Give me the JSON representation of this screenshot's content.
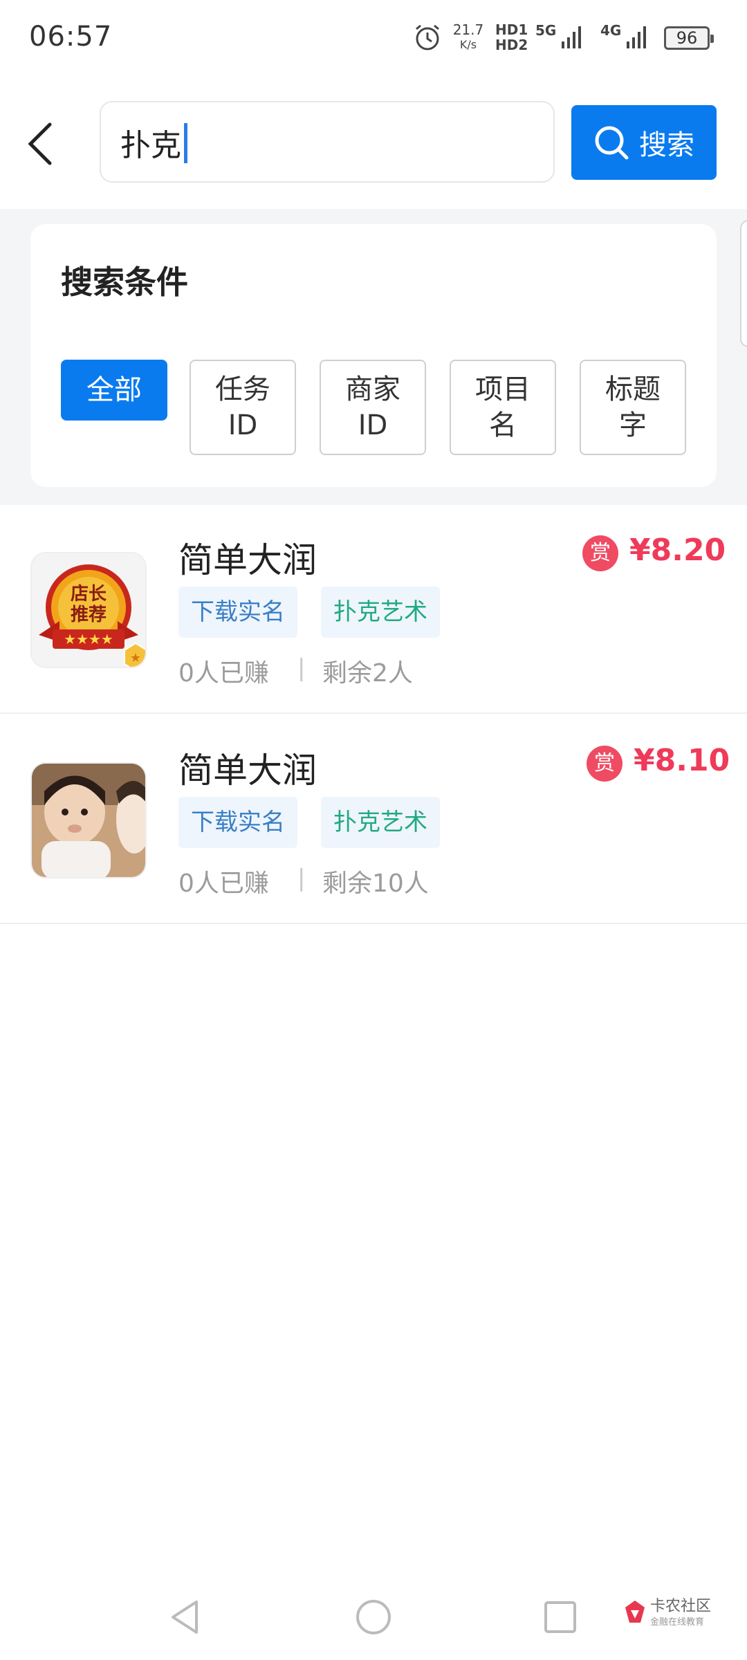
{
  "status_bar": {
    "time": "06:57",
    "net_speed_value": "21.7",
    "net_speed_unit": "K/s",
    "hd1": "HD1",
    "hd2": "HD2",
    "network_5g": "5G",
    "network_4g": "4G",
    "battery": "96"
  },
  "search": {
    "query": "扑克",
    "button_label": "搜索"
  },
  "filter": {
    "title": "搜索条件",
    "options": [
      {
        "label": "全部",
        "active": true
      },
      {
        "label": "任务\nID",
        "active": false
      },
      {
        "label": "商家\nID",
        "active": false
      },
      {
        "label": "项目\n名",
        "active": false
      },
      {
        "label": "标题\n字",
        "active": false
      }
    ],
    "active_color": "#0a7bef"
  },
  "tasks": [
    {
      "title": "简单大润",
      "reward_icon": "赏",
      "price": "¥8.20",
      "tags": [
        "下载实名",
        "扑克艺术"
      ],
      "earned": "0人已赚",
      "remaining": "剩余2人",
      "badge_lines": [
        "店长",
        "推荐"
      ],
      "thumb": "shop-recommend-badge"
    },
    {
      "title": "简单大润",
      "reward_icon": "赏",
      "price": "¥8.10",
      "tags": [
        "下载实名",
        "扑克艺术"
      ],
      "earned": "0人已赚",
      "remaining": "剩余10人",
      "thumb": "child-photo"
    }
  ],
  "watermark": {
    "name": "卡农社区",
    "subtitle": "金融在线教育"
  },
  "colors": {
    "primary": "#0a7bef",
    "price": "#ef3a59",
    "tag_blue": "#3a7fc5",
    "tag_green": "#22a982"
  }
}
